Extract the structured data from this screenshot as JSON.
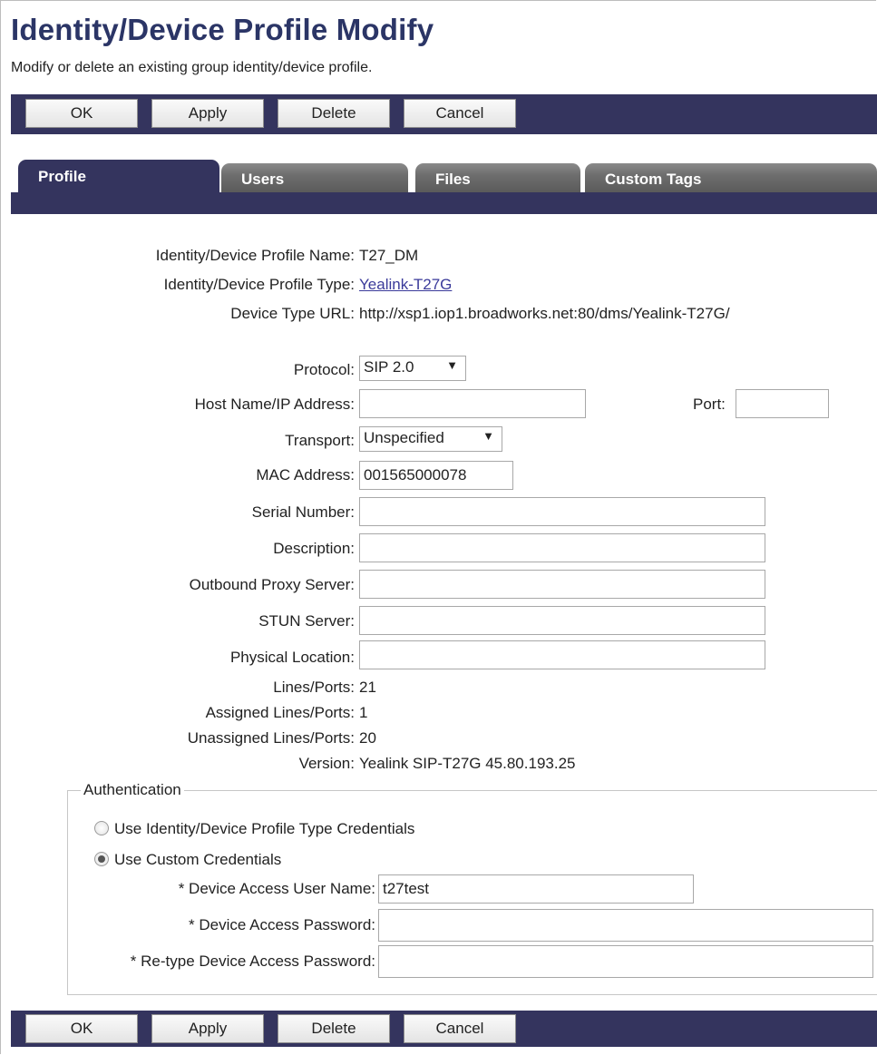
{
  "page": {
    "title": "Identity/Device Profile Modify",
    "subtitle": "Modify or delete an existing group identity/device profile."
  },
  "buttons": {
    "ok": "OK",
    "apply": "Apply",
    "delete": "Delete",
    "cancel": "Cancel"
  },
  "tabs": [
    {
      "label": "Profile",
      "active": true
    },
    {
      "label": "Users",
      "active": false
    },
    {
      "label": "Files",
      "active": false
    },
    {
      "label": "Custom Tags",
      "active": false
    }
  ],
  "profile": {
    "name_label": "Identity/Device Profile Name:",
    "name_value": "T27_DM",
    "type_label": "Identity/Device Profile Type:",
    "type_value": "Yealink-T27G",
    "url_label": "Device Type URL:",
    "url_value": "http://xsp1.iop1.broadworks.net:80/dms/Yealink-T27G/"
  },
  "form": {
    "protocol_label": "Protocol:",
    "protocol_value": "SIP 2.0",
    "host_label": "Host Name/IP Address:",
    "host_value": "",
    "port_label": "Port:",
    "port_value": "",
    "transport_label": "Transport:",
    "transport_value": "Unspecified",
    "mac_label": "MAC Address:",
    "mac_value": "001565000078",
    "serial_label": "Serial Number:",
    "serial_value": "",
    "description_label": "Description:",
    "description_value": "",
    "proxy_label": "Outbound Proxy Server:",
    "proxy_value": "",
    "stun_label": "STUN Server:",
    "stun_value": "",
    "location_label": "Physical Location:",
    "location_value": ""
  },
  "info": {
    "lines_label": "Lines/Ports:",
    "lines_value": "21",
    "assigned_label": "Assigned Lines/Ports:",
    "assigned_value": "1",
    "unassigned_label": "Unassigned Lines/Ports:",
    "unassigned_value": "20",
    "version_label": "Version:",
    "version_value": "Yealink SIP-T27G 45.80.193.25"
  },
  "auth": {
    "legend": "Authentication",
    "option_type": "Use Identity/Device Profile Type Credentials",
    "option_custom": "Use Custom Credentials",
    "selected": "custom",
    "username_label": "* Device Access User Name:",
    "username_value": "t27test",
    "password_label": "* Device Access Password:",
    "password_value": "",
    "retype_label": "* Re-type Device Access Password:",
    "retype_value": ""
  }
}
